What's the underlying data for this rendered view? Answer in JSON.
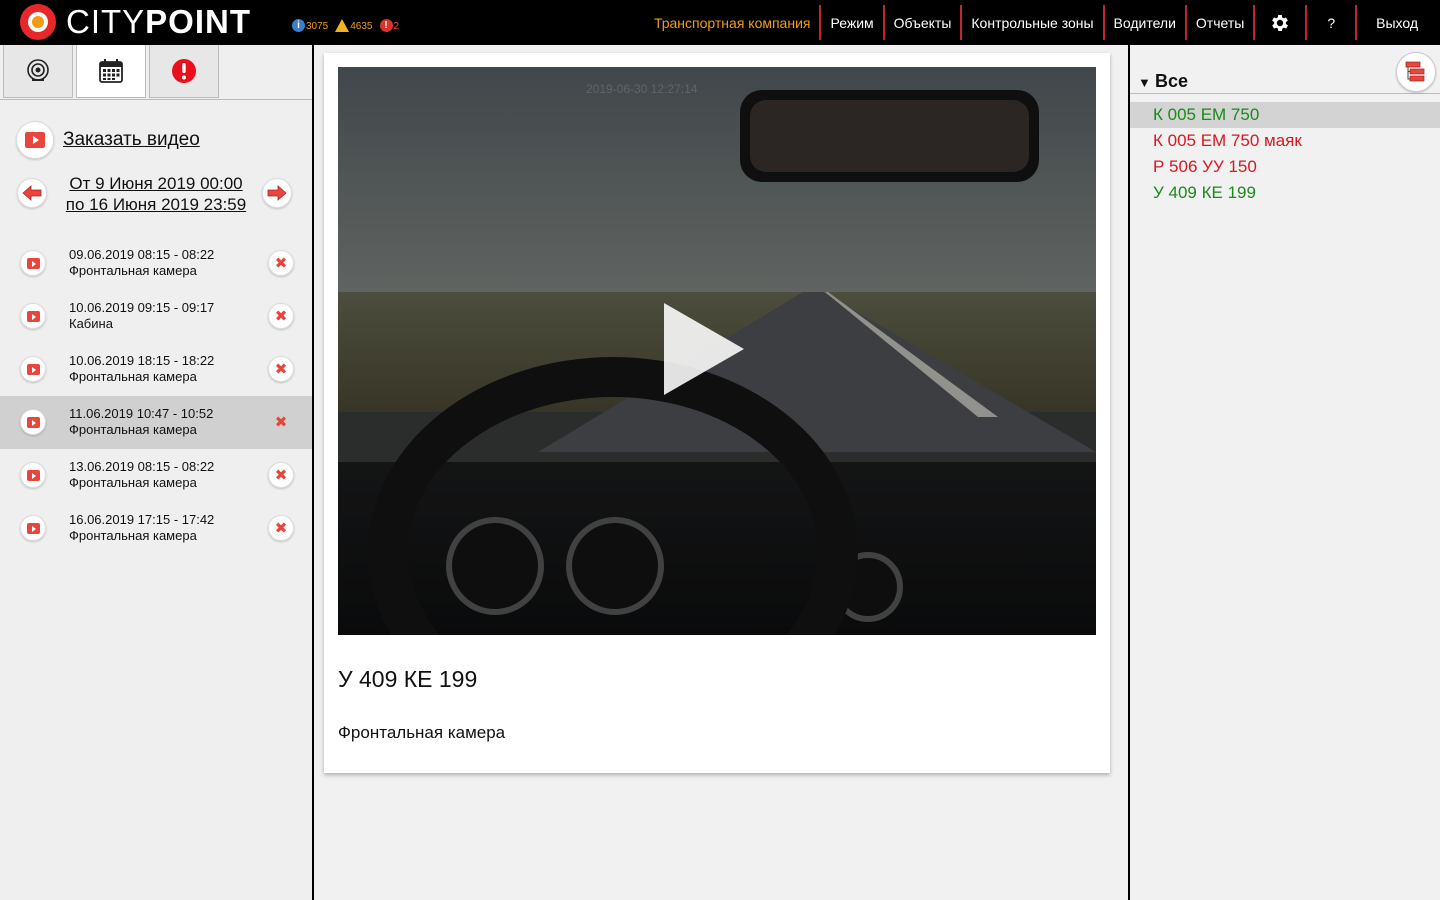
{
  "brand": {
    "light": "CITY",
    "bold": "POINT"
  },
  "indicators": [
    {
      "name": "info-icon",
      "count": "3075"
    },
    {
      "name": "warning-icon",
      "count": "4635"
    },
    {
      "name": "error-icon",
      "count": "2"
    }
  ],
  "nav": {
    "company": "Транспортная компания",
    "mode": "Режим",
    "objects": "Объекты",
    "zones": "Контрольные зоны",
    "drivers": "Водители",
    "reports": "Отчеты",
    "help": "?",
    "exit": "Выход"
  },
  "colors": {
    "accent": "#f39c12",
    "brand_red": "#e8272a",
    "online": "#1a8a1a",
    "offline": "#d9181f",
    "separator": "#c0262b"
  },
  "left": {
    "tabs": [
      "camera-icon",
      "calendar-icon",
      "alert-icon"
    ],
    "order_label": "Заказать видео",
    "period_from": "От 9 Июня 2019 00:00",
    "period_to": "по 16 Июня 2019 23:59",
    "videos": [
      {
        "time": "09.06.2019 08:15 - 08:22",
        "camera": "Фронтальная камера"
      },
      {
        "time": "10.06.2019 09:15 - 09:17",
        "camera": "Кабина"
      },
      {
        "time": "10.06.2019 18:15 - 18:22",
        "camera": "Фронтальная камера"
      },
      {
        "time": "11.06.2019 10:47 - 10:52",
        "camera": "Фронтальная камера"
      },
      {
        "time": "13.06.2019 08:15 - 08:22",
        "camera": "Фронтальная камера"
      },
      {
        "time": "16.06.2019 17:15 - 17:42",
        "camera": "Фронтальная камера"
      }
    ]
  },
  "player": {
    "timestamp": "2019-06-30 12:27:14",
    "title": "У 409 КЕ 199",
    "camera": "Фронтальная камера"
  },
  "right": {
    "toggle": "▼",
    "all_label": "Все",
    "vehicles": [
      {
        "plate": "К 005 ЕМ 750",
        "status": "online"
      },
      {
        "plate": "К 005 ЕМ 750 маяк",
        "status": "offline"
      },
      {
        "plate": "Р 506 УУ 150",
        "status": "offline"
      },
      {
        "plate": "У 409 КЕ 199",
        "status": "online"
      }
    ]
  }
}
